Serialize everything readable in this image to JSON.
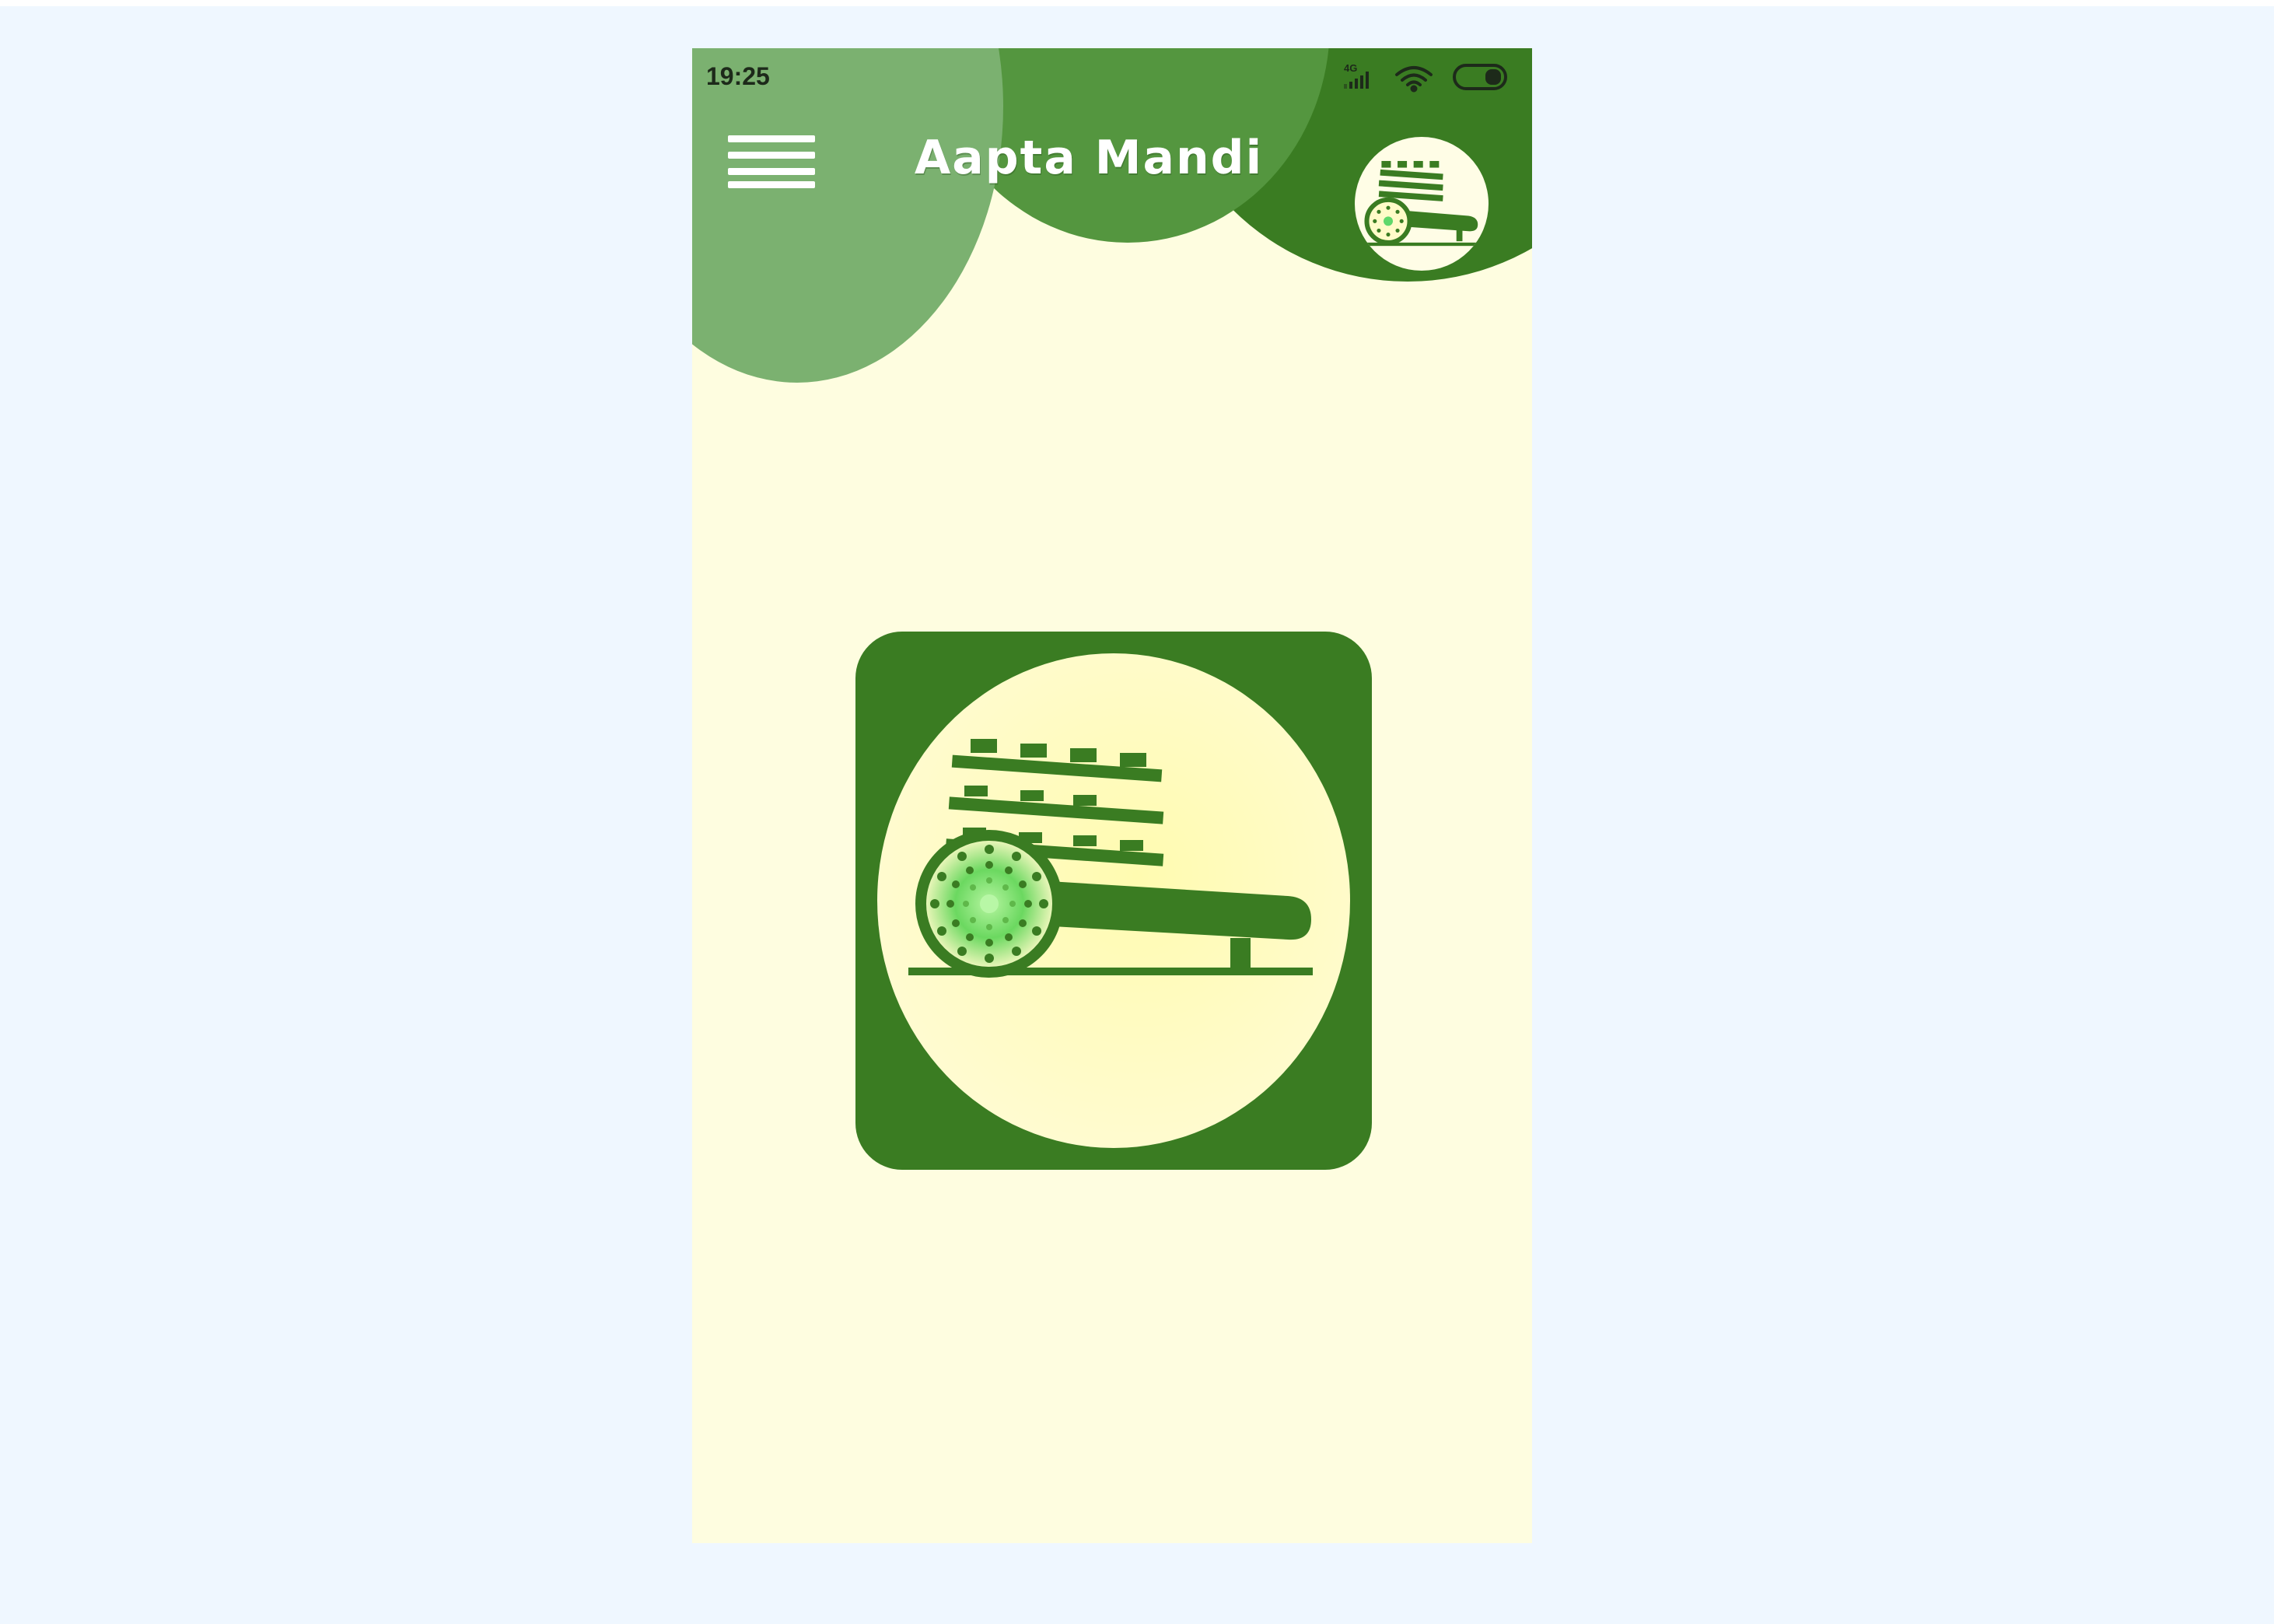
{
  "status_bar": {
    "time": "19:25",
    "network_label": "4G",
    "icons": [
      "signal-icon",
      "wifi-icon",
      "battery-icon"
    ]
  },
  "header": {
    "title": "Aapta Mandi",
    "menu_icon": "hamburger-menu-icon",
    "avatar_icon": "bullock-cart-logo-icon"
  },
  "main": {
    "logo_icon": "bullock-cart-logo-icon"
  },
  "colors": {
    "page_background": "#eff7ff",
    "screen_background": "#fefde0",
    "dark_green": "#3a7c22",
    "mid_green": "#54963f",
    "light_green": "#7bb170",
    "cream": "#fffbc8",
    "accent_green": "#5fd86a"
  }
}
